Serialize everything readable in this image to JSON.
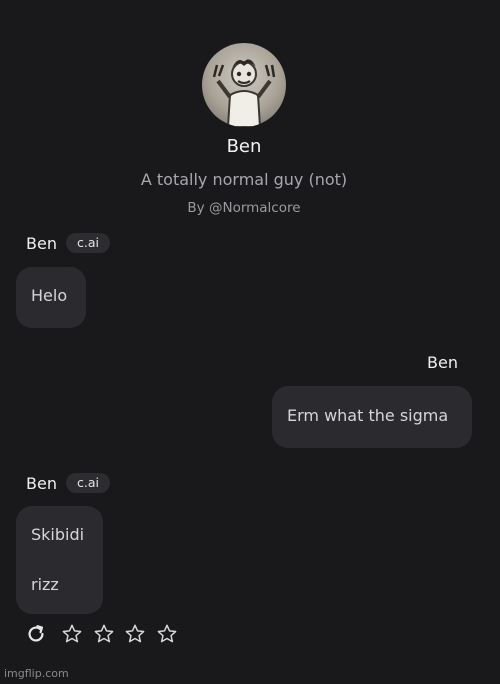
{
  "character": {
    "name": "Ben",
    "tagline": "A totally normal guy (not)",
    "creator": "By @Normalcore",
    "avatar_icon": "character-avatar"
  },
  "messages": [
    {
      "sender": "Ben",
      "badge": "c.ai",
      "role": "character",
      "lines": [
        "Helo"
      ]
    },
    {
      "sender": "Ben",
      "role": "user",
      "lines": [
        "Erm what the sigma"
      ]
    },
    {
      "sender": "Ben",
      "badge": "c.ai",
      "role": "character",
      "lines": [
        "Skibidi",
        "rizz"
      ]
    }
  ],
  "actions": {
    "reload_icon": "reload-icon",
    "star_icon": "star-outline-icon",
    "star_count": 4,
    "rating": 0
  },
  "watermark": "imgflip.com",
  "colors": {
    "background": "#19191c",
    "bubble": "#2a2a2f",
    "badge": "#2c2c31"
  }
}
